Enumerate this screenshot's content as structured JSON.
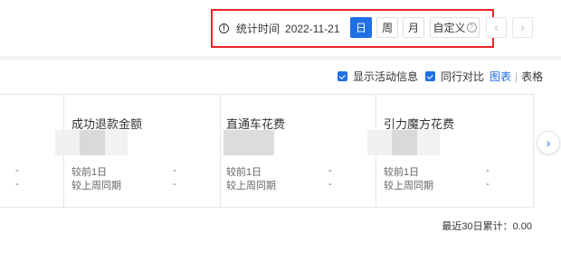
{
  "toolbar": {
    "stat_label": "统计时间",
    "stat_date": "2022-11-21",
    "day_label": "日",
    "week_label": "周",
    "month_label": "月",
    "custom_label": "自定义",
    "prev_arrow": "‹",
    "next_arrow": "›"
  },
  "options": {
    "show_activity_label": "显示活动信息",
    "compare_label": "同行对比",
    "chart_link": "图表",
    "separator": "|",
    "table_link": "表格"
  },
  "cards": [
    {
      "title": "",
      "compare_day": "",
      "compare_week": "",
      "day_value": "-",
      "week_value": "-"
    },
    {
      "title": "成功退款金额",
      "compare_day": "较前1日",
      "compare_week": "较上周同期",
      "day_value": "-",
      "week_value": "-"
    },
    {
      "title": "直通车花费",
      "compare_day": "较前1日",
      "compare_week": "较上周同期",
      "day_value": "-",
      "week_value": "-"
    },
    {
      "title": "引力魔方花费",
      "compare_day": "较前1日",
      "compare_week": "较上周同期",
      "day_value": "-",
      "week_value": "-"
    }
  ],
  "footer": {
    "cumulative": "最近30日累计：0.00"
  },
  "colors": {
    "accent": "#1f6fe5",
    "highlight_border": "#e8262b"
  }
}
